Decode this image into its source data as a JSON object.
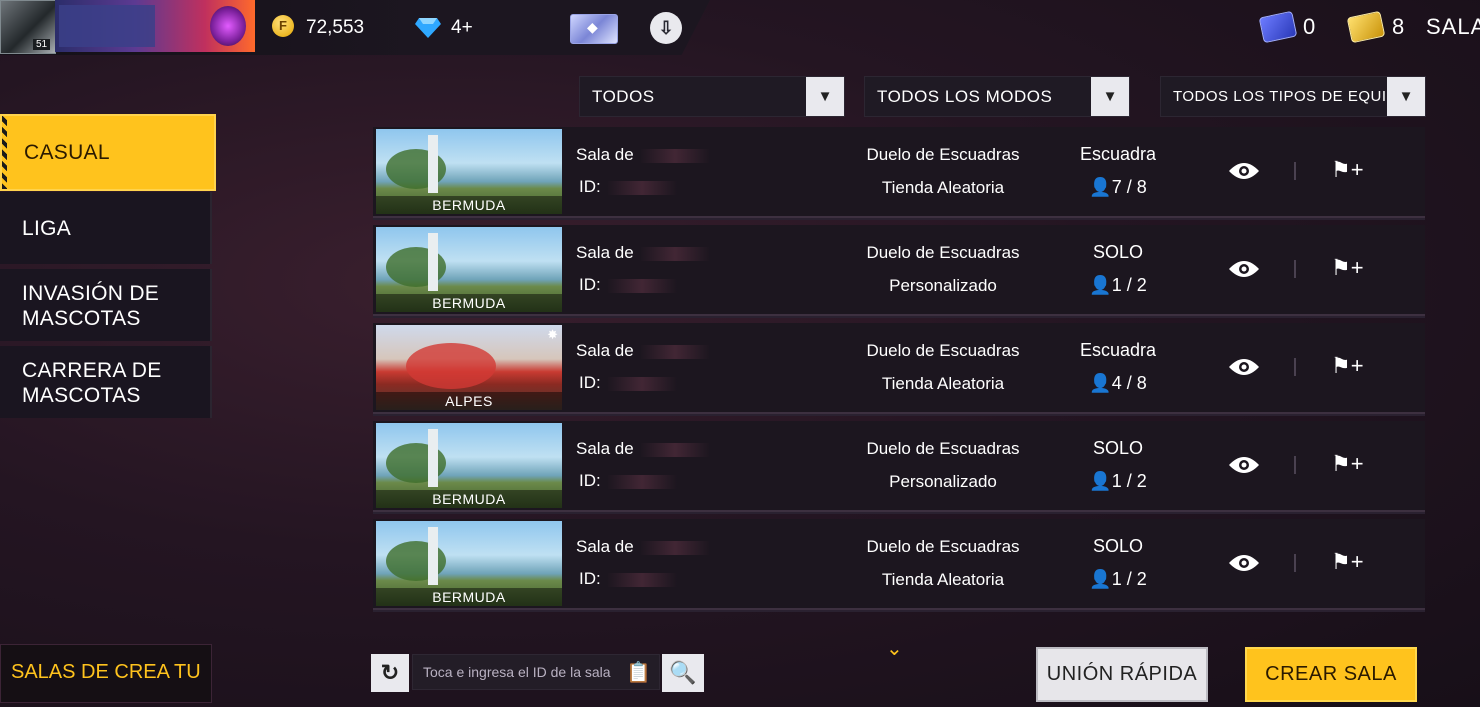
{
  "header": {
    "avatar_level": "51",
    "gold": "72,553",
    "diamonds": "4+",
    "ticket_blue_count": "0",
    "ticket_gold_count": "8",
    "sala_label": "SALA"
  },
  "filters": [
    {
      "label": "TODOS"
    },
    {
      "label": "TODOS LOS MODOS"
    },
    {
      "label": "TODOS LOS TIPOS DE EQUIPO"
    }
  ],
  "sidebar": {
    "items": [
      {
        "label": "CASUAL",
        "active": true
      },
      {
        "label": "LIGA"
      },
      {
        "label": "INVASIÓN DE MASCOTAS"
      },
      {
        "label": "CARRERA DE MASCOTAS"
      }
    ],
    "footer_banner": "SALAS DE CREA TU I"
  },
  "rooms": [
    {
      "map": "BERMUDA",
      "name": "Sala de",
      "id": "ID:",
      "mode": "Duelo de Escuadras",
      "store": "Tienda Aleatoria",
      "team_type": "Escuadra",
      "players": "7 / 8"
    },
    {
      "map": "BERMUDA",
      "name": "Sala de",
      "id": "ID:",
      "mode": "Duelo de Escuadras",
      "store": "Personalizado",
      "team_type": "SOLO",
      "players": "1 / 2"
    },
    {
      "map": "ALPES",
      "name": "Sala de",
      "id": "ID:",
      "mode": "Duelo de Escuadras",
      "store": "Tienda Aleatoria",
      "team_type": "Escuadra",
      "players": "4 / 8"
    },
    {
      "map": "BERMUDA",
      "name": "Sala de",
      "id": "ID:",
      "mode": "Duelo de Escuadras",
      "store": "Personalizado",
      "team_type": "SOLO",
      "players": "1 / 2"
    },
    {
      "map": "BERMUDA",
      "name": "Sala de",
      "id": "ID:",
      "mode": "Duelo de Escuadras",
      "store": "Tienda Aleatoria",
      "team_type": "SOLO",
      "players": "1 / 2"
    }
  ],
  "bottom": {
    "id_placeholder": "Toca e ingresa el ID de la sala",
    "join_label": "UNIÓN RÁPIDA",
    "create_label": "CREAR SALA"
  },
  "colors": {
    "accent": "#ffc31d",
    "panel": "#1c161f"
  }
}
